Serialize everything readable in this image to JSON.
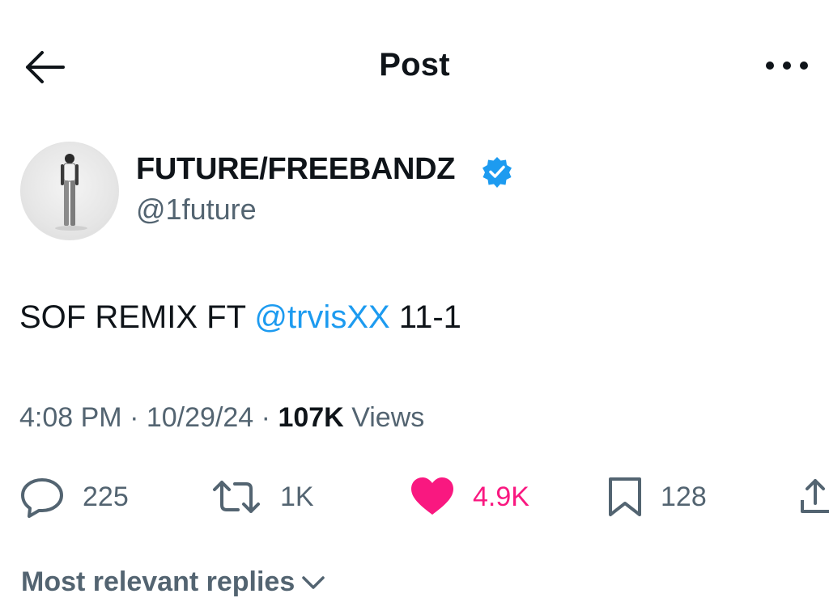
{
  "header": {
    "title": "Post",
    "back_icon": "arrow-left-icon",
    "more_icon": "more-horizontal-icon"
  },
  "author": {
    "display_name": "FUTURE/FREEBANDZ",
    "handle": "@1future",
    "verified": true,
    "verified_color": "#1d9bf0"
  },
  "post": {
    "text_before": "SOF REMIX FT ",
    "mention": "@trvisXX",
    "text_after": " 11-1"
  },
  "meta": {
    "time": "4:08 PM",
    "separator": "·",
    "date": "10/29/24",
    "views_count": "107K",
    "views_label": "Views"
  },
  "actions": {
    "replies": "225",
    "reposts": "1K",
    "likes": "4.9K",
    "bookmarks": "128"
  },
  "replies_sort": {
    "label": "Most relevant replies"
  },
  "colors": {
    "text": "#0f1419",
    "secondary": "#536471",
    "accent": "#1d9bf0",
    "like": "#f91880"
  }
}
